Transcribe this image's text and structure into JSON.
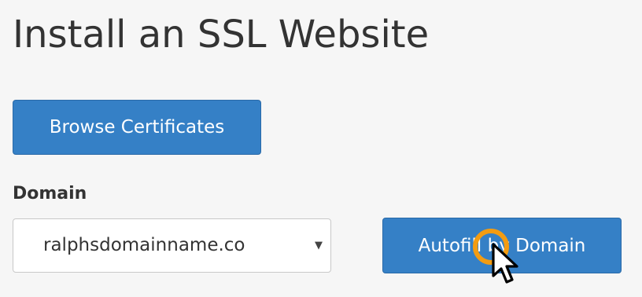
{
  "page": {
    "title": "Install an SSL Website"
  },
  "buttons": {
    "browse_label": "Browse Certificates",
    "autofill_label": "Autofill by Domain"
  },
  "domain_field": {
    "label": "Domain",
    "selected_value": "ralphsdomainname.co"
  },
  "colors": {
    "button_primary": "#3580c6",
    "page_background": "#f6f6f6",
    "click_highlight": "#f39c12"
  },
  "icons": {
    "select_caret": "caret-down-icon",
    "cursor": "mouse-pointer-icon",
    "click_indicator": "click-ring-icon"
  }
}
